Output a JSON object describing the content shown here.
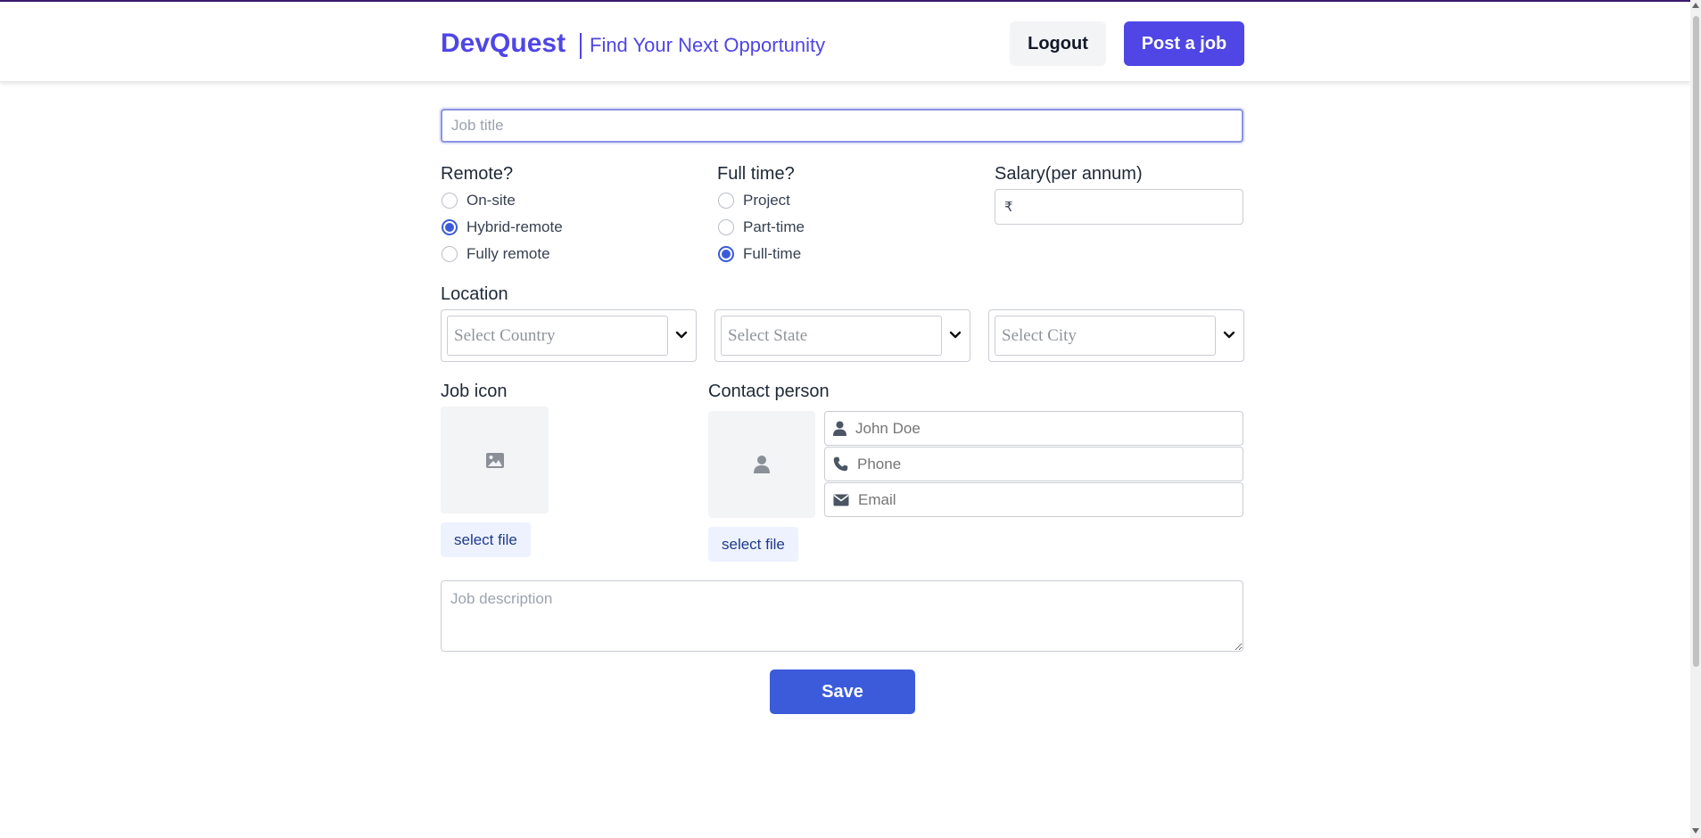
{
  "header": {
    "brand": "DevQuest",
    "tagline": "Find Your Next Opportunity",
    "logout_label": "Logout",
    "post_job_label": "Post a job"
  },
  "form": {
    "job_title_placeholder": "Job title",
    "remote": {
      "label": "Remote?",
      "options": [
        {
          "label": "On-site",
          "checked": false
        },
        {
          "label": "Hybrid-remote",
          "checked": true
        },
        {
          "label": "Fully remote",
          "checked": false
        }
      ]
    },
    "full_time": {
      "label": "Full time?",
      "options": [
        {
          "label": "Project",
          "checked": false
        },
        {
          "label": "Part-time",
          "checked": false
        },
        {
          "label": "Full-time",
          "checked": true
        }
      ]
    },
    "salary": {
      "label": "Salary(per annum)",
      "currency_symbol": "₹",
      "value": ""
    },
    "location": {
      "label": "Location",
      "country_placeholder": "Select Country",
      "state_placeholder": "Select State",
      "city_placeholder": "Select City"
    },
    "job_icon": {
      "label": "Job icon",
      "select_file_label": "select file"
    },
    "contact": {
      "label": "Contact person",
      "name_placeholder": "John Doe",
      "phone_placeholder": "Phone",
      "email_placeholder": "Email",
      "select_file_label": "select file"
    },
    "description_placeholder": "Job description",
    "save_label": "Save"
  },
  "icons": {
    "image": "image-icon",
    "user": "user-icon",
    "phone": "phone-icon",
    "email": "envelope-icon",
    "chevron": "chevron-down-icon"
  },
  "colors": {
    "brand": "#4f46e5",
    "primary_button": "#3b5bdb",
    "radio_checked": "#3b5bdb"
  }
}
